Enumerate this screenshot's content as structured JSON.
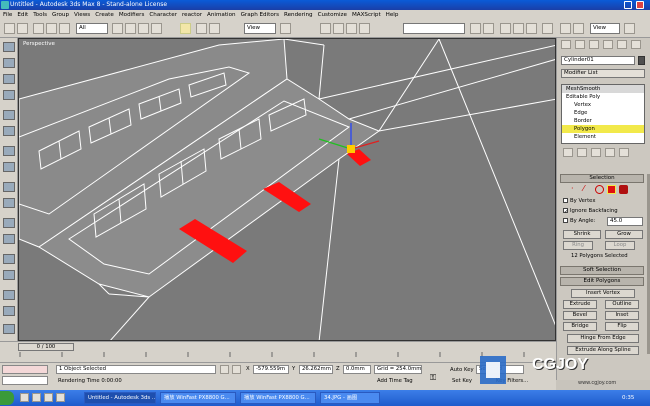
{
  "window": {
    "title": "Untitled - Autodesk 3ds Max 8 - Stand-alone License"
  },
  "menu": [
    "File",
    "Edit",
    "Tools",
    "Group",
    "Views",
    "Create",
    "Modifiers",
    "Character",
    "reactor",
    "Animation",
    "Graph Editors",
    "Rendering",
    "Customize",
    "MAXScript",
    "Help"
  ],
  "toolbar": {
    "filter_value": "All",
    "ref_coord_value": "View",
    "right_view_value": "View"
  },
  "viewport": {
    "label": "Perspective"
  },
  "command_panel": {
    "object_name": "Cylinder01",
    "modifier_list": "Modifier List",
    "stack": [
      "MeshSmooth",
      "Editable Poly",
      "Vertex",
      "Edge",
      "Border",
      "Polygon",
      "Element"
    ],
    "selected_subobject": "Polygon",
    "selection_rollout": "Selection",
    "by_vertex": "By Vertex",
    "ignore_backfacing": "Ignore Backfacing",
    "by_angle": "By Angle:",
    "angle_value": "45.0",
    "shrink": "Shrink",
    "grow": "Grow",
    "ring": "Ring",
    "loop": "Loop",
    "selection_status": "12 Polygons Selected",
    "soft_selection": "Soft Selection",
    "edit_polygons": "Edit Polygons",
    "insert_vertex": "Insert Vertex",
    "extrude": "Extrude",
    "outline": "Outline",
    "bevel": "Bevel",
    "inset": "Inset",
    "bridge": "Bridge",
    "flip": "Flip",
    "hinge_from_edge": "Hinge From Edge",
    "extrude_along_spline": "Extrude Along Spline"
  },
  "timeline": {
    "frame": "0 / 100"
  },
  "status": {
    "selected": "1 Object Selected",
    "render_time": "Rendering Time  0:00:00",
    "x": "-579.559m",
    "y": "26.262mm",
    "z": "0.0mm",
    "grid": "Grid = 254.0mm",
    "add_time_tag": "Add Time Tag",
    "auto_key": "Auto Key",
    "set_key": "Set Key",
    "key_filters": "Key Filters...",
    "selected_drop": "Selected"
  },
  "taskbar": {
    "items": [
      "Untitled - Autodesk 3ds ...",
      "播放 WinFast PX8800 G...",
      "播放 WinFast PX8800 G...",
      "34.JPG - 画图"
    ],
    "clock": "0:35"
  },
  "watermark": {
    "text": "CGJOY",
    "url": "www.cgjoy.com"
  },
  "colors": {
    "selected_polygon": "#ff1010",
    "viewport_bg": "#7a7a7a",
    "wire": "#ffffff"
  }
}
